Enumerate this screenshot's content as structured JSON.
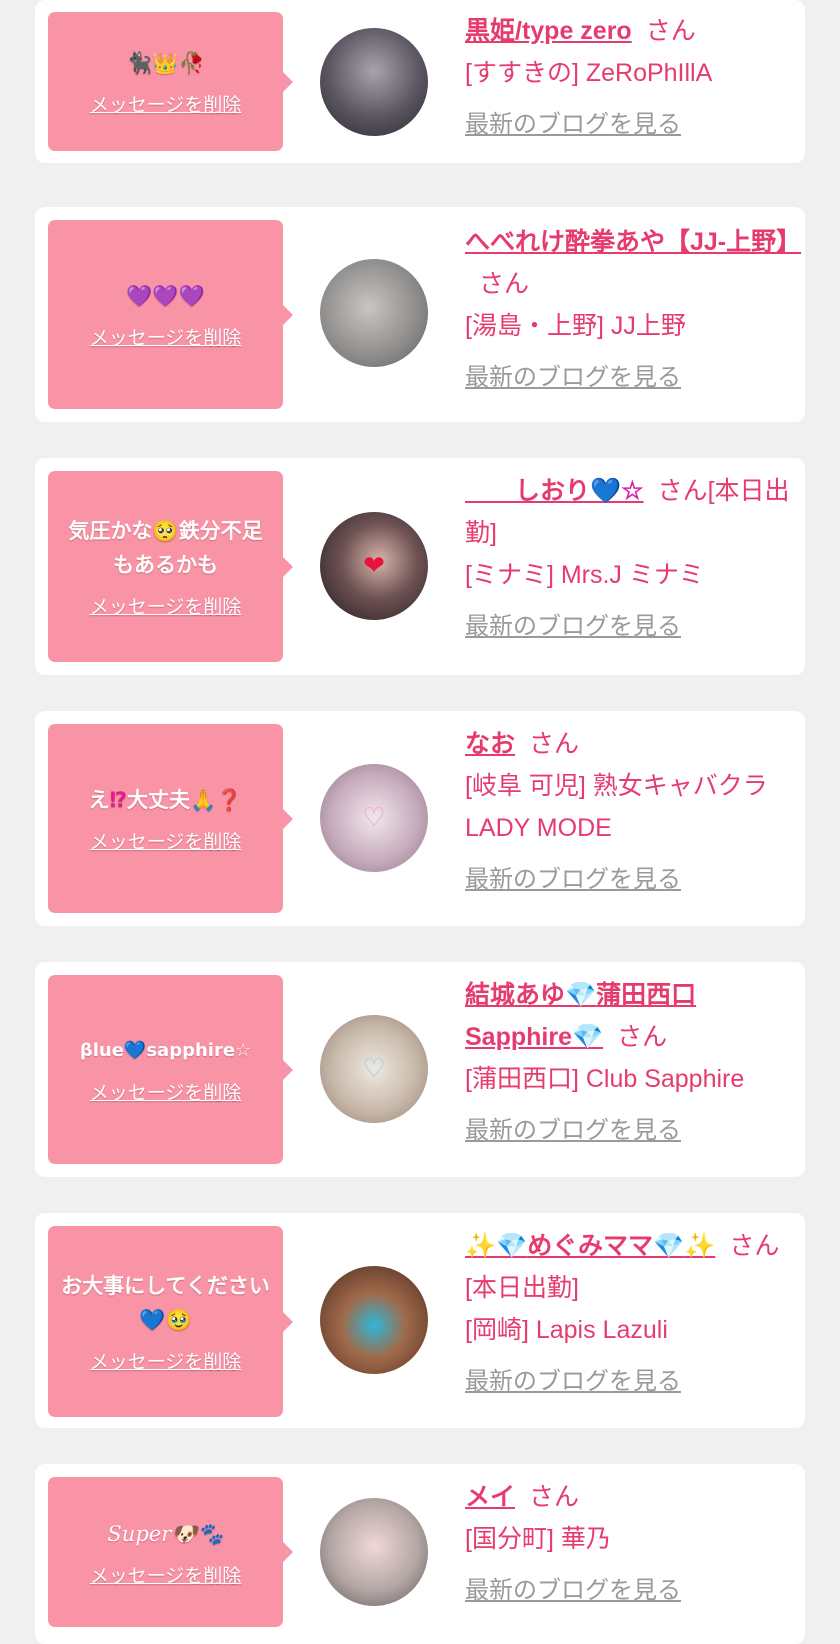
{
  "delete_label": "メッセージを削除",
  "blog_label": "最新のブログを見る",
  "san_label": "さん",
  "colors": {
    "bubble": "#f993a6",
    "name": "#e63b6e",
    "link_gray": "#9a9a9a",
    "card": "#ffffff",
    "page": "#f0f0f0"
  },
  "items": [
    {
      "message_icons": [
        "🐈‍⬛",
        "👑",
        "🥀"
      ],
      "name": "黒姫/type zero",
      "shop": "[すすきの] ZeRoPhIllA",
      "avatar_bg": "#6f6b75"
    },
    {
      "message_icons": [
        "💜",
        "💜",
        "💜"
      ],
      "name": "へべれけ酔拳あや【JJ-上野】",
      "shop": "[湯島・上野] JJ上野",
      "avatar_bg": "#9b9a99"
    },
    {
      "message_parts": [
        "気圧かな",
        "🥺",
        "鉄分不足もあるかも"
      ],
      "name_parts": [
        "　　しおり",
        "💙",
        "☆"
      ],
      "san_suffix": "[本日出勤]",
      "shop": "[ミナミ] Mrs.J ミナミ",
      "avatar_bg": "#3a2f33",
      "avatar_sticker": "❤"
    },
    {
      "message_parts": [
        "え",
        "⁉",
        "大丈夫",
        "🙏",
        "❓"
      ],
      "name": "なお",
      "shop": "[岐阜 可児] 熟女キャバクラLADY MODE",
      "avatar_bg": "#c9b8c4",
      "avatar_sticker": "♡"
    },
    {
      "message_parts": [
        "βlue",
        "💙",
        "sapphire☆"
      ],
      "name_parts": [
        "結城あゆ",
        "💎",
        "蒲田西口Sapphire",
        "💎"
      ],
      "shop": "[蒲田西口] Club Sapphire",
      "avatar_bg": "#d9cfc6",
      "avatar_sticker": "♡"
    },
    {
      "message_parts": [
        "お大事にしてください",
        "💙",
        "🥹"
      ],
      "name_parts": [
        "✨",
        "💎",
        "めぐみママ",
        "💎",
        "✨"
      ],
      "san_suffix": "[本日出勤]",
      "shop": "[岡崎] Lapis Lazuli",
      "avatar_bg": "#7a4e3a"
    },
    {
      "message_parts": [
        "Super",
        "🐶",
        "🐾"
      ],
      "name": "メイ",
      "shop": "[国分町] 華乃",
      "avatar_bg": "#b8b2b0"
    }
  ]
}
